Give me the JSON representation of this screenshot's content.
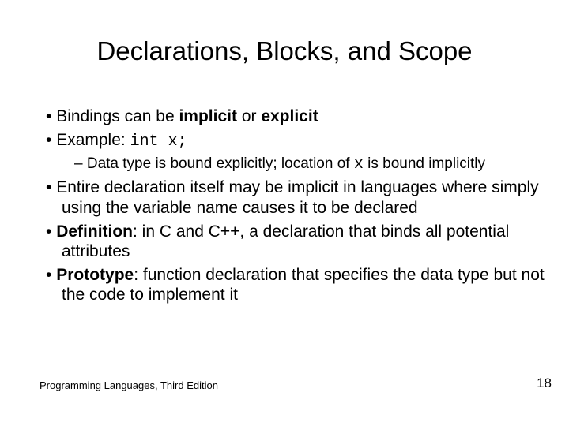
{
  "title": "Declarations, Blocks, and Scope",
  "bullets": {
    "b1a_pre": "Bindings can be ",
    "b1a_implicit": "implicit",
    "b1a_mid": " or ",
    "b1a_explicit": "explicit",
    "b2_label": "Example:  ",
    "b2_code": "int x;",
    "sub1_pre": "Data type is bound explicitly; location of ",
    "sub1_x": "x",
    "sub1_post": " is bound implicitly",
    "b3": "Entire declaration itself may be implicit in languages where simply using the variable name causes it to be declared",
    "b4_term": "Definition",
    "b4_rest": ": in C and C++, a declaration that binds all potential attributes",
    "b5_term": "Prototype",
    "b5_rest": ": function declaration that specifies the data type but not the code to implement it"
  },
  "footer": {
    "left": "Programming Languages, Third Edition",
    "page": "18"
  }
}
